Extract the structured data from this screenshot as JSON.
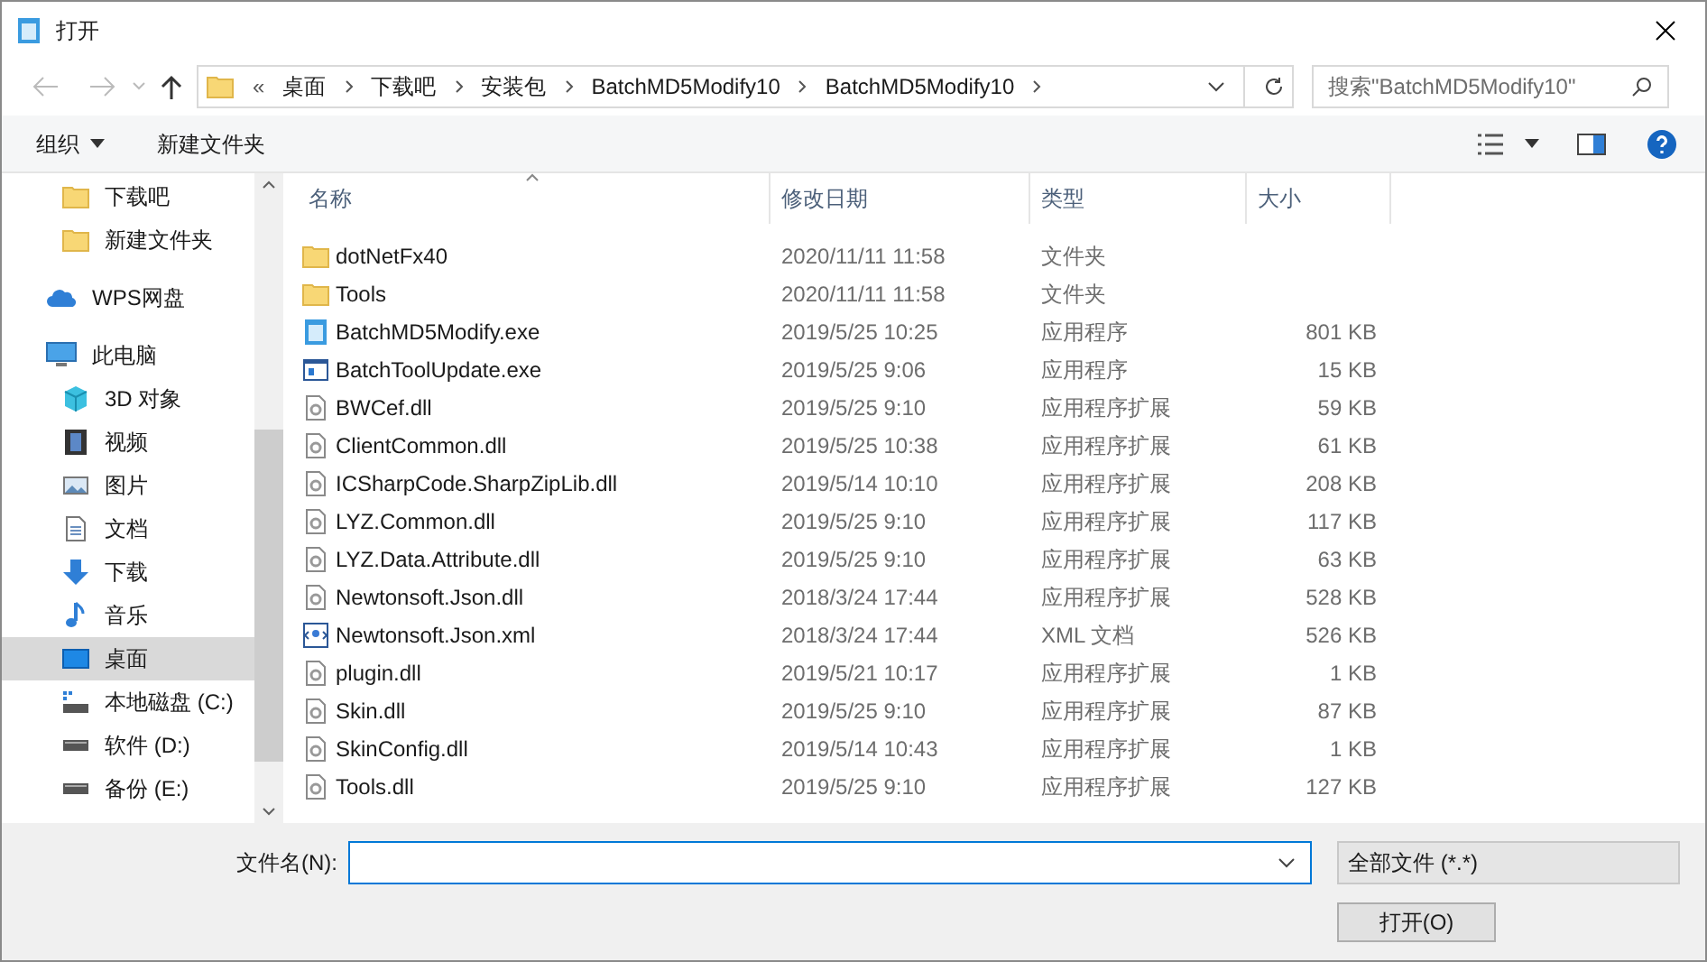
{
  "window": {
    "title": "打开"
  },
  "address": {
    "overflow": "«",
    "crumbs": [
      "桌面",
      "下载吧",
      "安装包",
      "BatchMD5Modify10",
      "BatchMD5Modify10"
    ]
  },
  "search": {
    "placeholder": "搜索\"BatchMD5Modify10\""
  },
  "toolbar": {
    "organize": "组织",
    "new_folder": "新建文件夹"
  },
  "sidebar": {
    "items": [
      {
        "children": [
          {
            "label": "下载吧",
            "kind": "folder",
            "selected": false
          },
          {
            "label": "新建文件夹",
            "kind": "folder",
            "selected": false
          }
        ]
      },
      {
        "label": "WPS网盘",
        "kind": "cloud",
        "selected": false
      },
      {
        "label": "此电脑",
        "kind": "pc",
        "selected": false,
        "children": [
          {
            "label": "3D 对象",
            "kind": "cube",
            "selected": false
          },
          {
            "label": "视频",
            "kind": "video",
            "selected": false
          },
          {
            "label": "图片",
            "kind": "image",
            "selected": false
          },
          {
            "label": "文档",
            "kind": "doc",
            "selected": false
          },
          {
            "label": "下载",
            "kind": "download",
            "selected": false
          },
          {
            "label": "音乐",
            "kind": "music",
            "selected": false
          },
          {
            "label": "桌面",
            "kind": "desktop",
            "selected": true
          },
          {
            "label": "本地磁盘 (C:)",
            "kind": "sysdrive",
            "selected": false
          },
          {
            "label": "软件 (D:)",
            "kind": "drive",
            "selected": false
          },
          {
            "label": "备份 (E:)",
            "kind": "drive",
            "selected": false
          }
        ]
      }
    ]
  },
  "table": {
    "columns": [
      "名称",
      "修改日期",
      "类型",
      "大小"
    ],
    "rows": [
      {
        "name": "dotNetFx40",
        "kind": "folder",
        "modified": "2020/11/11 11:58",
        "type": "文件夹"
      },
      {
        "name": "Tools",
        "kind": "folder",
        "modified": "2020/11/11 11:58",
        "type": "文件夹"
      },
      {
        "name": "BatchMD5Modify.exe",
        "kind": "app",
        "modified": "2019/5/25 10:25",
        "type": "应用程序",
        "size": "801 KB"
      },
      {
        "name": "BatchToolUpdate.exe",
        "kind": "window",
        "modified": "2019/5/25 9:06",
        "type": "应用程序",
        "size": "15 KB"
      },
      {
        "name": "BWCef.dll",
        "kind": "dll",
        "modified": "2019/5/25 9:10",
        "type": "应用程序扩展",
        "size": "59 KB"
      },
      {
        "name": "ClientCommon.dll",
        "kind": "dll",
        "modified": "2019/5/25 10:38",
        "type": "应用程序扩展",
        "size": "61 KB"
      },
      {
        "name": "ICSharpCode.SharpZipLib.dll",
        "kind": "dll",
        "modified": "2019/5/14 10:10",
        "type": "应用程序扩展",
        "size": "208 KB"
      },
      {
        "name": "LYZ.Common.dll",
        "kind": "dll",
        "modified": "2019/5/25 9:10",
        "type": "应用程序扩展",
        "size": "117 KB"
      },
      {
        "name": "LYZ.Data.Attribute.dll",
        "kind": "dll",
        "modified": "2019/5/25 9:10",
        "type": "应用程序扩展",
        "size": "63 KB"
      },
      {
        "name": "Newtonsoft.Json.dll",
        "kind": "dll",
        "modified": "2018/3/24 17:44",
        "type": "应用程序扩展",
        "size": "528 KB"
      },
      {
        "name": "Newtonsoft.Json.xml",
        "kind": "xml",
        "modified": "2018/3/24 17:44",
        "type": "XML 文档",
        "size": "526 KB"
      },
      {
        "name": "plugin.dll",
        "kind": "dll",
        "modified": "2019/5/21 10:17",
        "type": "应用程序扩展",
        "size": "1 KB"
      },
      {
        "name": "Skin.dll",
        "kind": "dll",
        "modified": "2019/5/25 9:10",
        "type": "应用程序扩展",
        "size": "87 KB"
      },
      {
        "name": "SkinConfig.dll",
        "kind": "dll",
        "modified": "2019/5/14 10:43",
        "type": "应用程序扩展",
        "size": "1 KB"
      },
      {
        "name": "Tools.dll",
        "kind": "dll",
        "modified": "2019/5/25 9:10",
        "type": "应用程序扩展",
        "size": "127 KB"
      }
    ]
  },
  "footer": {
    "filename_label": "文件名(N):",
    "filter": "全部文件 (*.*)",
    "open_button": "打开(O)"
  }
}
